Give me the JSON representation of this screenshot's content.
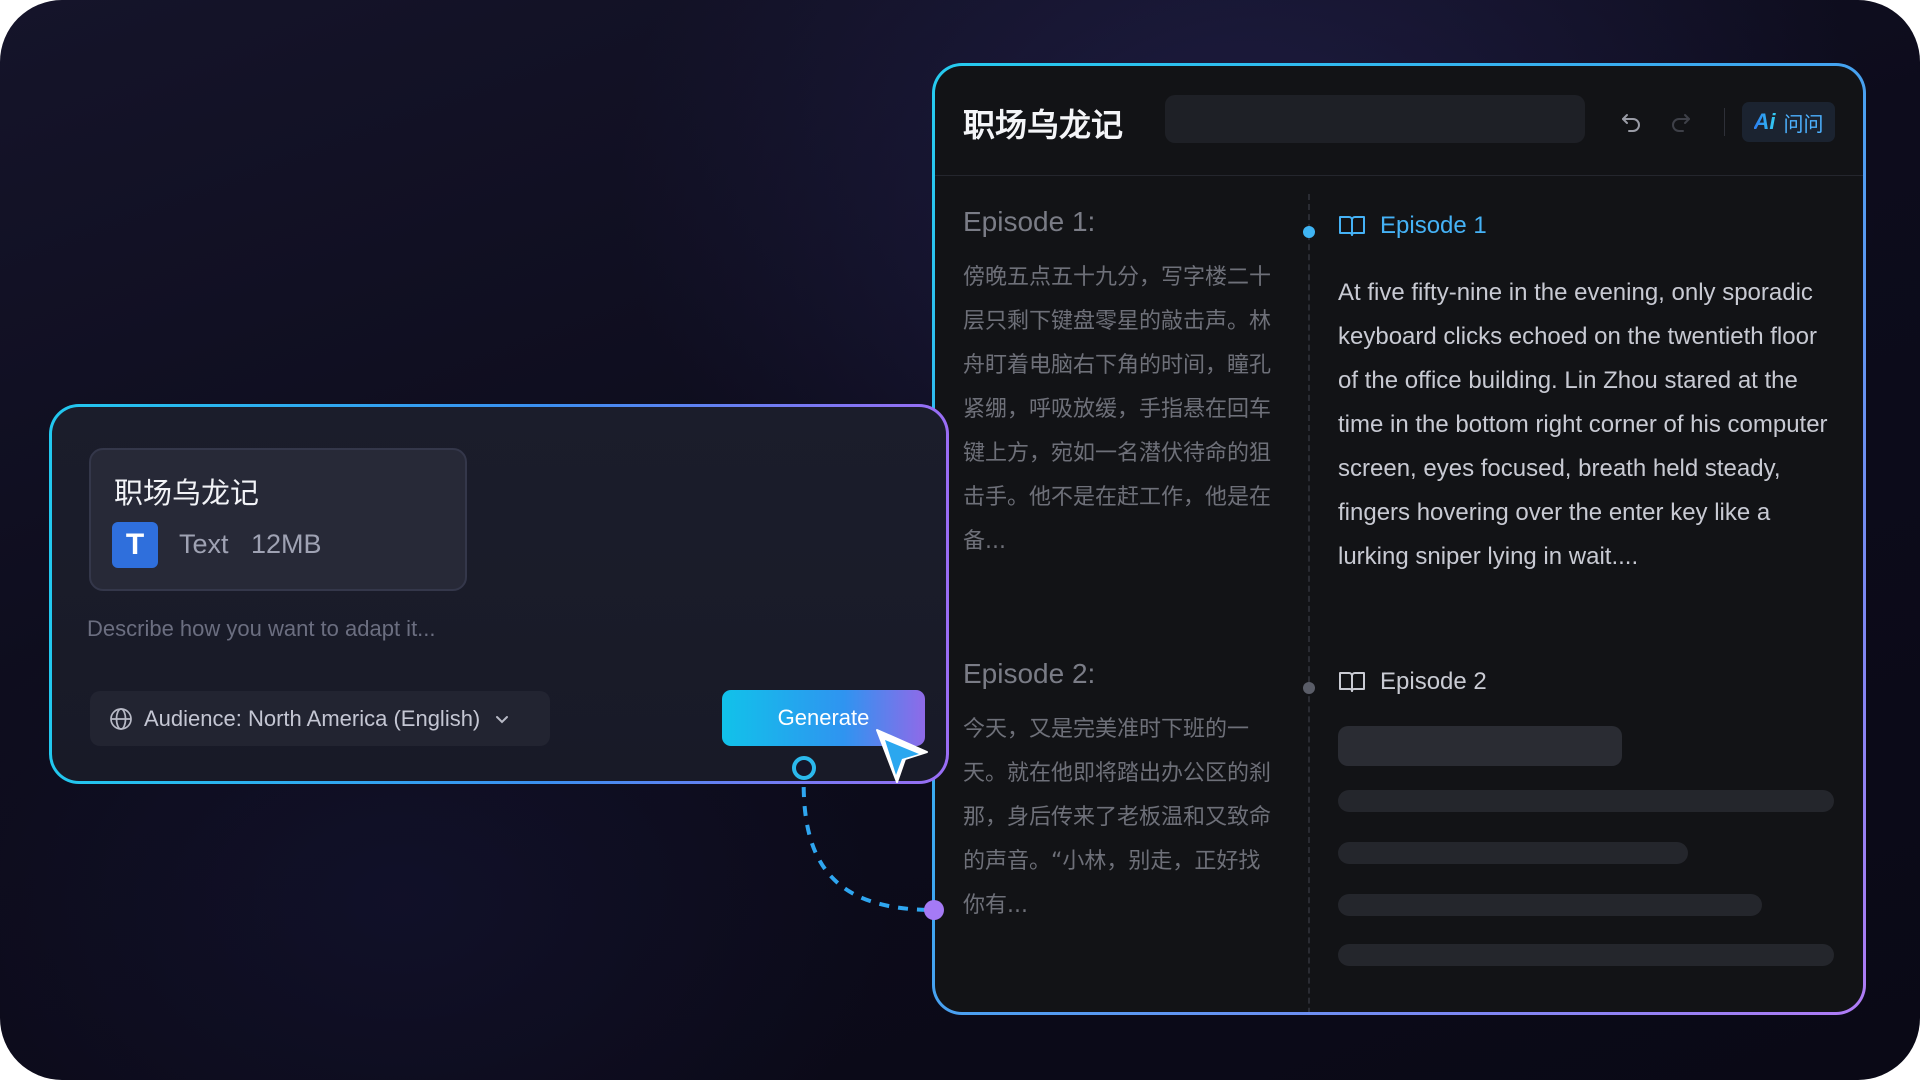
{
  "left_panel": {
    "file": {
      "title": "职场乌龙记",
      "icon_letter": "T",
      "type": "Text",
      "size": "12MB"
    },
    "prompt_placeholder": "Describe how you want to adapt it...",
    "audience": "Audience: North America (English)",
    "generate_label": "Generate"
  },
  "right_panel": {
    "title": "职场乌龙记",
    "ask_label": "问问",
    "ai_logo_text": "Ai",
    "source": {
      "episode1": {
        "heading": "Episode 1:",
        "text": "傍晚五点五十九分，写字楼二十层只剩下键盘零星的敲击声。林舟盯着电脑右下角的时间，瞳孔紧绷，呼吸放缓，手指悬在回车键上方，宛如一名潜伏待命的狙击手。他不是在赶工作，他是在备..."
      },
      "episode2": {
        "heading": "Episode 2:",
        "text": "今天，又是完美准时下班的一天。就在他即将踏出办公区的刹那，身后传来了老板温和又致命的声音。“小林，别走，正好找你有..."
      }
    },
    "output": {
      "episode1_label": "Episode 1",
      "episode1_text": "At five fifty-nine in the evening, only sporadic keyboard clicks echoed on the twentieth floor of the office building. Lin Zhou stared at the time in the bottom right corner of his computer screen, eyes focused, breath held steady, fingers hovering over the enter key like a lurking sniper lying in wait....",
      "episode2_label": "Episode 2"
    }
  },
  "colors": {
    "accent_cyan": "#22c8ef",
    "accent_purple": "#9a6df5",
    "link_blue": "#45b2f6"
  },
  "icons": [
    "globe-icon",
    "chevron-down-icon",
    "undo-icon",
    "redo-icon",
    "book-icon",
    "cursor-arrow-icon",
    "ai-logo-icon"
  ]
}
